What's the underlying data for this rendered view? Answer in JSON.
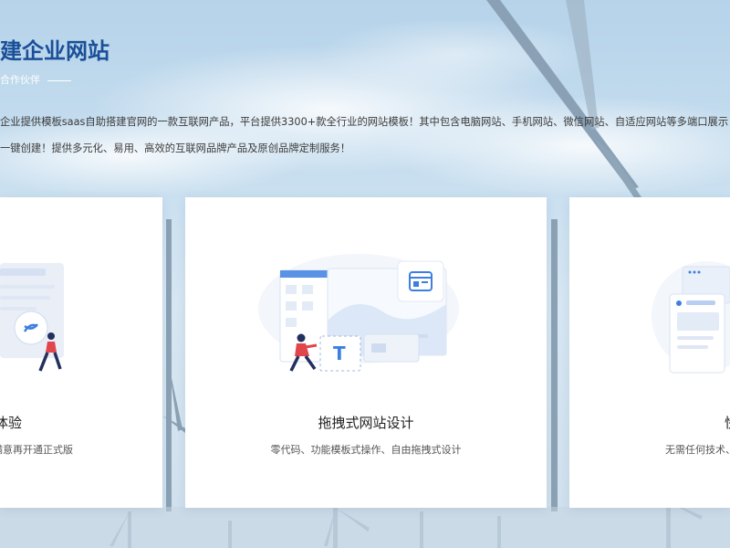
{
  "header": {
    "title": "建企业网站",
    "subtitle": "合作伙伴"
  },
  "intro": {
    "line1": "企业提供模板saas自助搭建官网的一款互联网产品，平台提供3300+款全行业的网站模板！其中包含电脑网站、手机网站、微信网站、自适应网站等多端口展示",
    "line2": "一键创建！提供多元化、易用、高效的互联网品牌产品及原创品牌定制服务！"
  },
  "cards": [
    {
      "title": "体验",
      "desc": "满意再开通正式版"
    },
    {
      "title": "拖拽式网站设计",
      "desc": "零代码、功能模板式操作、自由拖拽式设计"
    },
    {
      "title": "快",
      "desc": "无需任何技术、"
    }
  ],
  "colors": {
    "title": "#1a4f99",
    "accent_blue": "#3d7fe0",
    "person_red": "#e0464b",
    "person_navy": "#23305e"
  }
}
